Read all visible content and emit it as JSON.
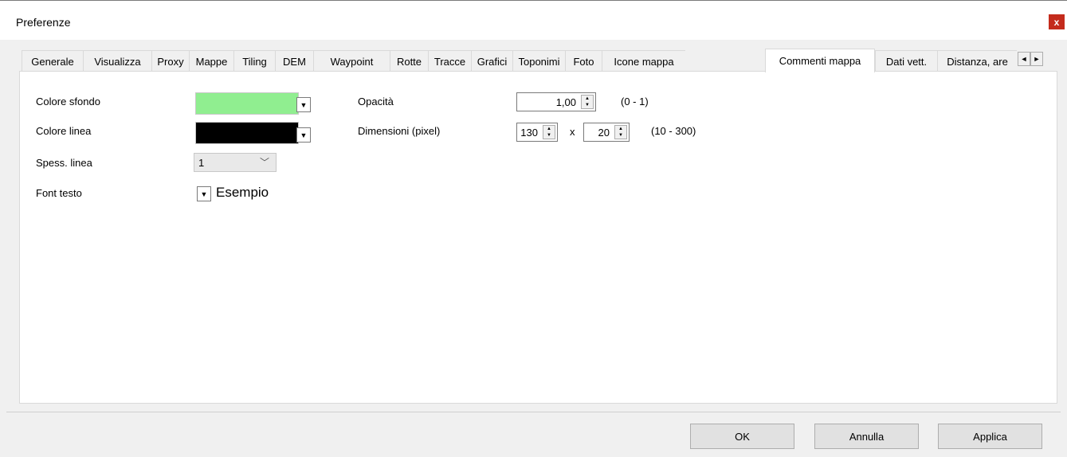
{
  "window": {
    "title": "Preferenze",
    "close_glyph": "x"
  },
  "tabs": [
    "Generale",
    "Visualizza",
    "Proxy",
    "Mappe",
    "Tiling",
    "DEM",
    "Waypoint",
    "Rotte",
    "Tracce",
    "Grafici",
    "Toponimi",
    "Foto",
    "Icone mappa",
    "Commenti mappa",
    "Dati vett.",
    "Distanza, are"
  ],
  "active_tab": "Commenti mappa",
  "tab_scroll": {
    "left_glyph": "◄",
    "right_glyph": "►"
  },
  "form": {
    "bg_color_label": "Colore sfondo",
    "bg_color_value": "#90ee90",
    "line_color_label": "Colore linea",
    "line_color_value": "#000000",
    "line_width_label": "Spess. linea",
    "line_width_value": "1",
    "font_label": "Font testo",
    "font_sample": "Esempio",
    "opacity_label": "Opacità",
    "opacity_value": "1,00",
    "opacity_range": "(0 - 1)",
    "size_label": "Dimensioni (pixel)",
    "width_value": "130",
    "size_sep": "x",
    "height_value": "20",
    "size_range": "(10 - 300)"
  },
  "buttons": {
    "ok": "OK",
    "cancel": "Annulla",
    "apply": "Applica"
  },
  "icons": {
    "dropdown": "dropdown-arrow-icon",
    "chevron": "chevron-down-icon",
    "spin": "spin-up-down-icon"
  }
}
